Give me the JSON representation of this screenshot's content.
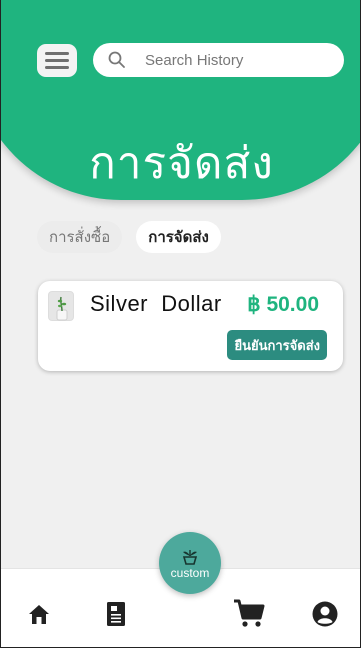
{
  "header": {
    "title": "การจัดส่ง",
    "menu_icon": "hamburger-menu-icon",
    "search": {
      "placeholder": "Search History",
      "icon": "search-icon"
    }
  },
  "tabs": [
    {
      "label": "การสั่งซื้อ",
      "active": false
    },
    {
      "label": "การจัดส่ง",
      "active": true
    }
  ],
  "orders": [
    {
      "name": "Silver  Dollar",
      "price": "฿ 50.00",
      "action_label": "ยืนยันการจัดส่ง",
      "thumbnail": "plant-thumbnail"
    }
  ],
  "custom_button": {
    "label": "custom",
    "icon": "plant-pot-icon"
  },
  "bottom_nav": {
    "items": [
      {
        "icon": "home-icon"
      },
      {
        "icon": "document-icon"
      },
      {
        "icon": "cart-icon"
      },
      {
        "icon": "profile-icon"
      }
    ]
  },
  "colors": {
    "primary": "#1fb47f",
    "confirm_button": "#2c8c80",
    "custom_button": "#4da99c",
    "nav_icon": "#222222"
  }
}
